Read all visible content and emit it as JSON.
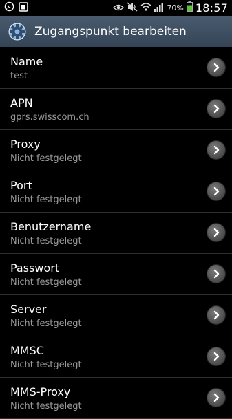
{
  "status_bar": {
    "icons": [
      "whatsapp-icon",
      "messenger-icon",
      "eye-icon",
      "mute-icon",
      "wifi-icon",
      "signal-icon",
      "battery-icon"
    ],
    "battery": "70%",
    "time": "18:57"
  },
  "action_bar": {
    "icon": "gear-icon",
    "title": "Zugangspunkt bearbeiten"
  },
  "items": [
    {
      "title": "Name",
      "value": "test"
    },
    {
      "title": "APN",
      "value": "gprs.swisscom.ch"
    },
    {
      "title": "Proxy",
      "value": "Nicht festgelegt"
    },
    {
      "title": "Port",
      "value": "Nicht festgelegt"
    },
    {
      "title": "Benutzername",
      "value": "Nicht festgelegt"
    },
    {
      "title": "Passwort",
      "value": "Nicht festgelegt"
    },
    {
      "title": "Server",
      "value": "Nicht festgelegt"
    },
    {
      "title": "MMSC",
      "value": "Nicht festgelegt"
    },
    {
      "title": "MMS-Proxy",
      "value": "Nicht festgelegt"
    }
  ],
  "colors": {
    "action_bar": "#3f4f62",
    "secondary_text": "#9a9a9a",
    "battery": "#5ec13c"
  }
}
